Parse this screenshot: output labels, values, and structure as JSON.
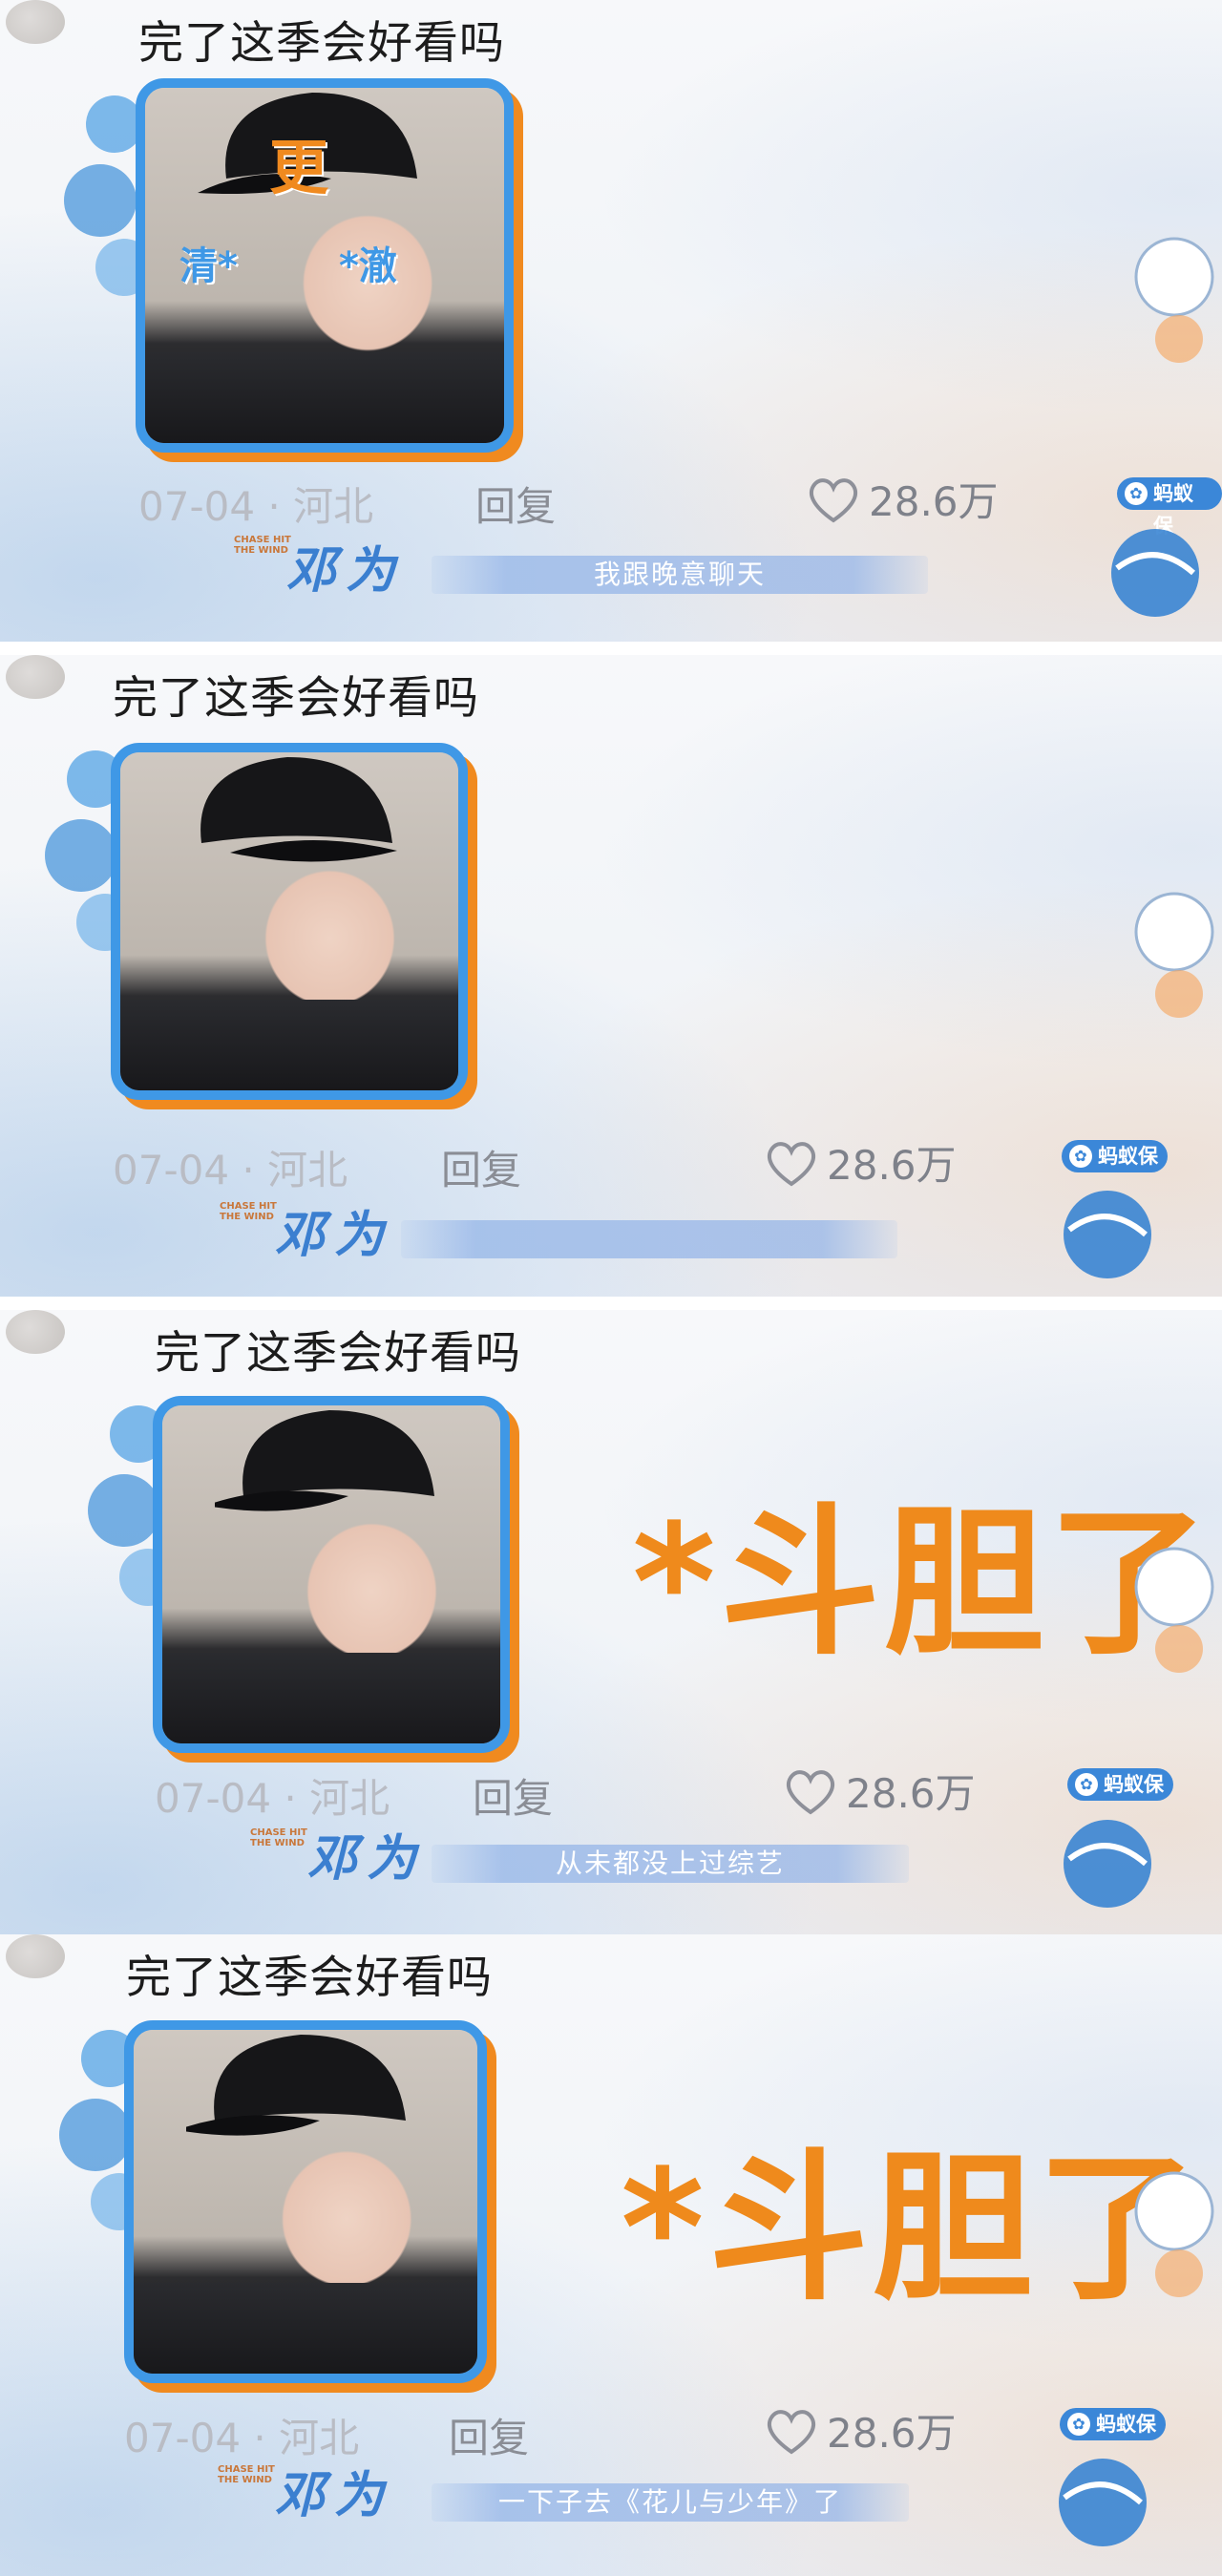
{
  "panels": [
    {
      "comment": "完了这季会好看吗",
      "date_location": "07-04 · 河北",
      "reply_label": "回复",
      "likes": "28.6万",
      "name_logo": "邓为",
      "name_sub": "CHASE HIT THE WIND",
      "subtitle": "我跟晚意聊天",
      "big_caption": "",
      "overlay_top": "更",
      "overlay_left": "清*",
      "overlay_right": "*澈"
    },
    {
      "comment": "完了这季会好看吗",
      "date_location": "07-04 · 河北",
      "reply_label": "回复",
      "likes": "28.6万",
      "name_logo": "邓为",
      "name_sub": "CHASE HIT THE WIND",
      "subtitle": "",
      "big_caption": ""
    },
    {
      "comment": "完了这季会好看吗",
      "date_location": "07-04 · 河北",
      "reply_label": "回复",
      "likes": "28.6万",
      "name_logo": "邓为",
      "name_sub": "CHASE HIT THE WIND",
      "subtitle": "从未都没上过综艺",
      "big_caption": "*斗胆了"
    },
    {
      "comment": "完了这季会好看吗",
      "date_location": "07-04 · 河北",
      "reply_label": "回复",
      "likes": "28.6万",
      "name_logo": "邓为",
      "name_sub": "CHASE HIT THE WIND",
      "subtitle": "一下子去《花儿与少年》了",
      "big_caption": "*斗胆了"
    }
  ],
  "watermark": {
    "label": "蚂蚁保",
    "icon": "shield-icon"
  },
  "colors": {
    "frame_blue": "#3f98e6",
    "frame_orange": "#f08a1f",
    "caption_orange": "#ef8a1c",
    "watermark_blue": "#3b87d8"
  }
}
